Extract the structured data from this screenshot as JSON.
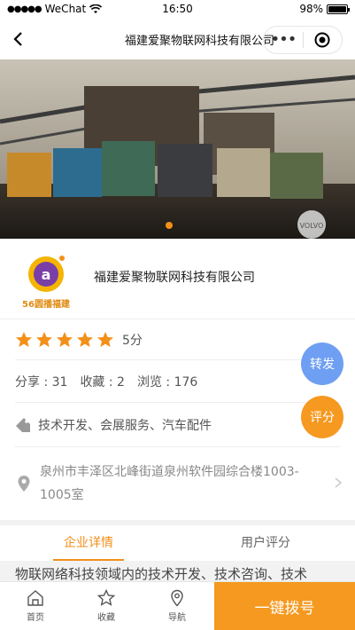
{
  "status_bar": {
    "signal": "●●●●●",
    "carrier": "WeChat",
    "time": "16:50",
    "battery": "98%",
    "battery_level": 0.98
  },
  "nav": {
    "title": "福建爱聚物联网科技有限公司",
    "more_label": "•••"
  },
  "banner": {
    "slide_count": 1,
    "active_index": 0,
    "watermark": "VOLVO"
  },
  "company": {
    "name": "福建爱聚物联网科技有限公司",
    "logo_text": "56圆播福建"
  },
  "rating": {
    "stars": 5,
    "label": "5分"
  },
  "stats": {
    "share": "分享 : 31",
    "favorites": "收藏 : 2",
    "views": "浏览 : 176"
  },
  "tags": "技术开发、会展服务、汽车配件",
  "address": "泉州市丰泽区北峰街道泉州软件园综合楼1003-1005室",
  "fabs": {
    "share": "转发",
    "rate": "评分"
  },
  "tabs": [
    {
      "label": "企业详情",
      "active": true
    },
    {
      "label": "用户评分",
      "active": false
    }
  ],
  "content": {
    "text": "物联网络科技领域内的技术开发、技术咨询、技术"
  },
  "bottom_bar": {
    "items": [
      {
        "label": "首页",
        "icon": "home-icon"
      },
      {
        "label": "收藏",
        "icon": "star-outline-icon"
      },
      {
        "label": "导航",
        "icon": "location-icon"
      }
    ],
    "call_label": "一键拨号"
  },
  "colors": {
    "accent": "#f39019",
    "share_fab": "#6f9ff2",
    "rate_fab": "#f59920",
    "star": "#f39019"
  }
}
